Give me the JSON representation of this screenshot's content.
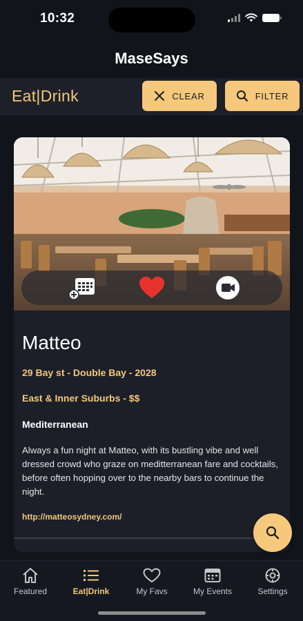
{
  "status_bar": {
    "time": "10:32"
  },
  "app": {
    "title": "MaseSays"
  },
  "header": {
    "section_title": "Eat|Drink",
    "clear_label": "CLEAR",
    "filter_label": "FILTER"
  },
  "venue": {
    "name": "Matteo",
    "address": "29 Bay st - Double Bay - 2028",
    "area": "East & Inner Suburbs - $$",
    "cuisine": "Mediterranean",
    "description": "Always a fun night at Matteo, with its bustling vibe and well dressed crowd who graze on meditterranean fare and cocktails, before often hopping over to the nearby bars to continue the night.",
    "url": "http://matteosydney.com/",
    "favorited": true
  },
  "actions": {
    "calendar_icon": "calendar-add-icon",
    "heart_icon": "heart-icon",
    "video_icon": "video-camera-icon"
  },
  "tabs": [
    {
      "label": "Featured",
      "icon": "home-icon",
      "active": false
    },
    {
      "label": "Eat|Drink",
      "icon": "list-icon",
      "active": true
    },
    {
      "label": "My Favs",
      "icon": "heart-outline-icon",
      "active": false
    },
    {
      "label": "My Events",
      "icon": "calendar-icon",
      "active": false
    },
    {
      "label": "Settings",
      "icon": "settings-icon",
      "active": false
    }
  ],
  "colors": {
    "accent": "#f5c87c",
    "accent_text": "#f2c87a",
    "background": "#12141b",
    "card": "#1c1f28",
    "heart": "#e8322c"
  }
}
